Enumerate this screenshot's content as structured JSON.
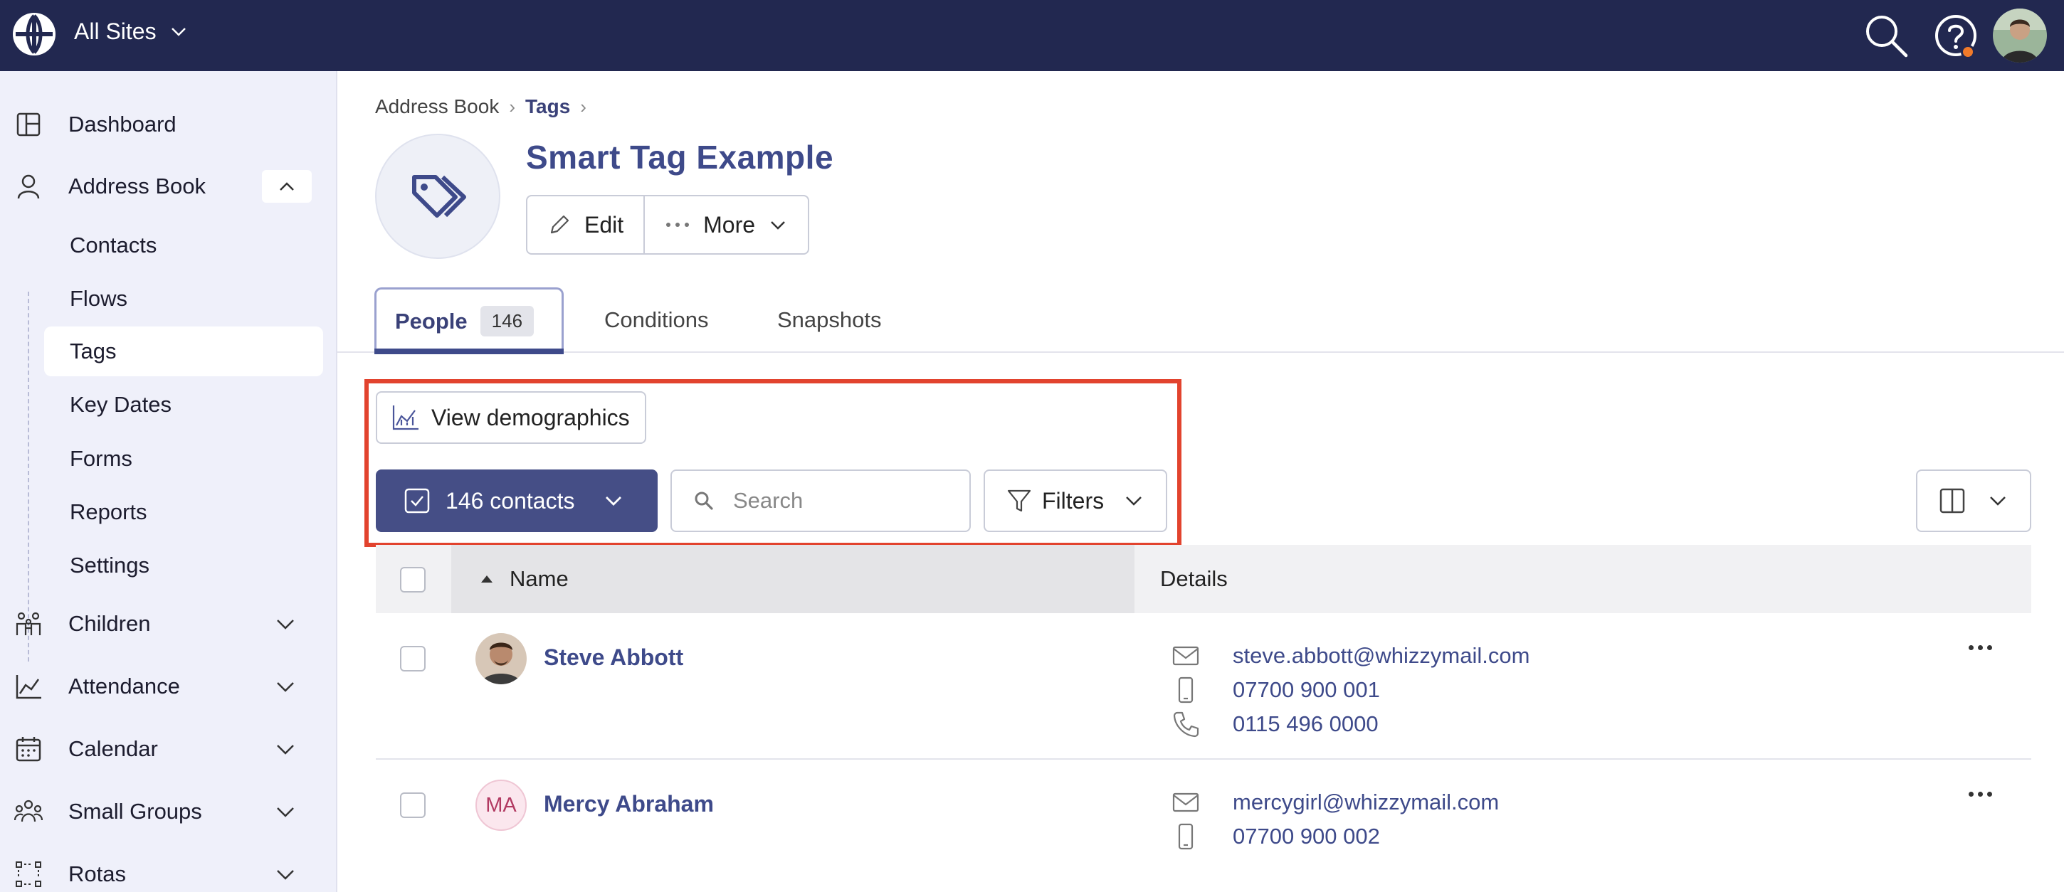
{
  "topbar": {
    "site_selector": "All Sites",
    "icons": [
      "globe-icon",
      "search-icon",
      "help-icon",
      "user-avatar"
    ]
  },
  "sidebar": {
    "items": [
      {
        "label": "Dashboard",
        "icon": "dashboard-icon"
      },
      {
        "label": "Address Book",
        "icon": "person-icon",
        "expanded": true
      },
      {
        "label": "Children",
        "icon": "children-icon"
      },
      {
        "label": "Attendance",
        "icon": "chart-icon"
      },
      {
        "label": "Calendar",
        "icon": "calendar-icon"
      },
      {
        "label": "Small Groups",
        "icon": "group-icon"
      },
      {
        "label": "Rotas",
        "icon": "rota-icon"
      }
    ],
    "address_book_sub": [
      "Contacts",
      "Flows",
      "Tags",
      "Key Dates",
      "Forms",
      "Reports",
      "Settings"
    ],
    "active_sub": "Tags"
  },
  "breadcrumb": {
    "root": "Address Book",
    "current": "Tags"
  },
  "header": {
    "title": "Smart Tag Example",
    "edit_label": "Edit",
    "more_label": "More"
  },
  "tabs": [
    {
      "label": "People",
      "badge": "146",
      "active": true
    },
    {
      "label": "Conditions"
    },
    {
      "label": "Snapshots"
    }
  ],
  "toolbar": {
    "demographics_label": "View demographics",
    "contacts_label": "146 contacts",
    "search_placeholder": "Search",
    "filters_label": "Filters"
  },
  "table": {
    "columns": [
      "Name",
      "Details"
    ],
    "rows": [
      {
        "name": "Steve Abbott",
        "avatar": "photo",
        "email": "steve.abbott@whizzymail.com",
        "mobile": "07700 900 001",
        "phone": "0115 496 0000"
      },
      {
        "name": "Mercy Abraham",
        "avatar_initials": "MA",
        "email": "mercygirl@whizzymail.com",
        "mobile": "07700 900 002"
      }
    ]
  },
  "colors": {
    "topbar": "#222850",
    "accent": "#3e4a8a",
    "highlight": "#e2432e",
    "sidebar": "#eff0fa"
  }
}
